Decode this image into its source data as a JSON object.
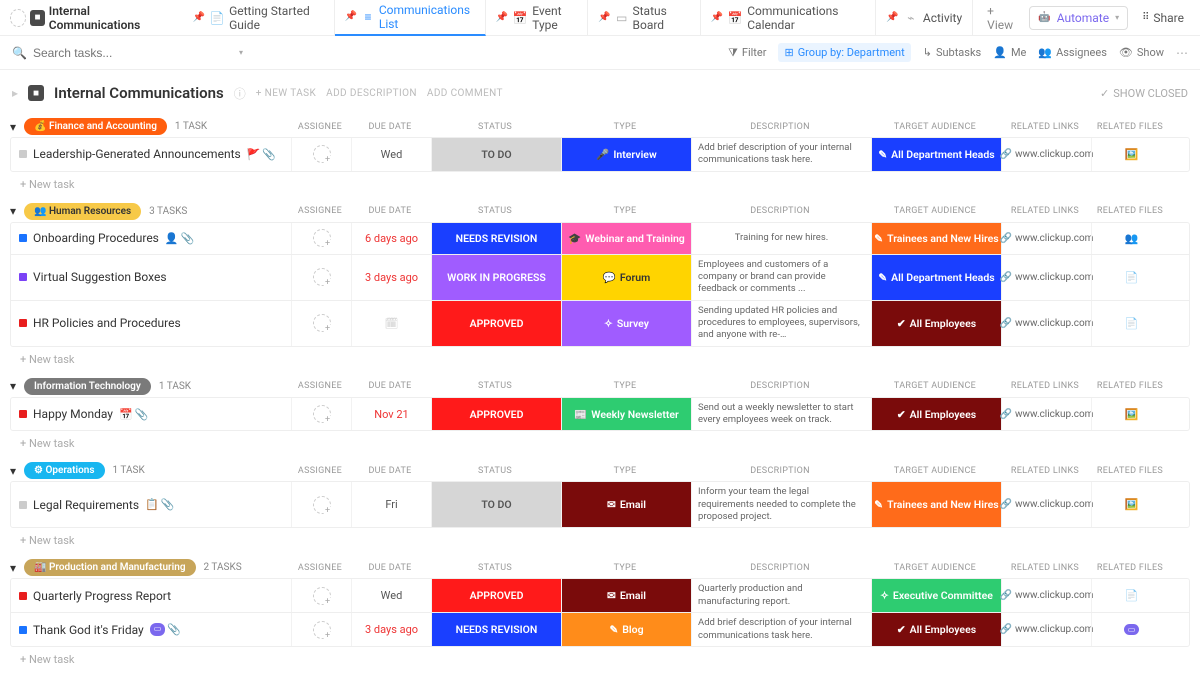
{
  "workspace": {
    "title": "Internal Communications"
  },
  "views": [
    {
      "label": "Getting Started Guide",
      "icon": "📄",
      "active": false
    },
    {
      "label": "Communications List",
      "icon": "≡",
      "active": true
    },
    {
      "label": "Event Type",
      "icon": "📅",
      "active": false
    },
    {
      "label": "Status Board",
      "icon": "▭",
      "active": false
    },
    {
      "label": "Communications Calendar",
      "icon": "📅",
      "active": false
    },
    {
      "label": "Activity",
      "icon": "⌁",
      "active": false
    }
  ],
  "add_view": "+ View",
  "automate": "Automate",
  "share": "Share",
  "search_placeholder": "Search tasks...",
  "toolbar": {
    "filter": "Filter",
    "group_by": "Group by: Department",
    "subtasks": "Subtasks",
    "me": "Me",
    "assignees": "Assignees",
    "show": "Show"
  },
  "page": {
    "title": "Internal Communications",
    "new_task": "+ NEW TASK",
    "add_description": "ADD DESCRIPTION",
    "add_comment": "ADD COMMENT",
    "show_closed": "SHOW CLOSED"
  },
  "columns": [
    "",
    "ASSIGNEE",
    "DUE DATE",
    "STATUS",
    "TYPE",
    "DESCRIPTION",
    "TARGET AUDIENCE",
    "RELATED LINKS",
    "RELATED FILES"
  ],
  "groups": [
    {
      "name": "Finance and Accounting",
      "pill_bg": "#ff5e0e",
      "icon": "💰",
      "task_count": "1 TASK",
      "tasks": [
        {
          "sq": "#ccc",
          "name": "Leadership-Generated Announcements",
          "badges": [
            "🚩",
            "📎"
          ],
          "due": "Wed",
          "due_color": "#555",
          "status": "TO DO",
          "status_bg": "#d6d6d6",
          "status_fg": "#555",
          "type": "Interview",
          "type_bg": "#1a3fff",
          "type_icon": "🎤",
          "desc": "Add brief description of your internal communications task here.",
          "aud": "All Department Heads",
          "aud_bg": "#1a3fff",
          "aud_icon": "✎",
          "link": "www.clickup.com",
          "file": "🖼️",
          "file_color": "#d66"
        }
      ]
    },
    {
      "name": "Human Resources",
      "pill_bg": "#f7c948",
      "pill_fg": "#333",
      "icon": "👥",
      "task_count": "3 TASKS",
      "tasks": [
        {
          "sq": "#1a73ff",
          "name": "Onboarding Procedures",
          "badges": [
            "👤",
            "📎"
          ],
          "due": "6 days ago",
          "due_color": "#e33",
          "status": "NEEDS REVISION",
          "status_bg": "#1a3fff",
          "type": "Webinar and Training",
          "type_bg": "#ff5cb0",
          "type_icon": "🎓",
          "desc": "Training for new hires.",
          "aud": "Trainees and New Hires",
          "aud_bg": "#ff6b1a",
          "aud_icon": "✎",
          "link": "www.clickup.com",
          "file": "👥",
          "file_color": "#333"
        },
        {
          "sq": "#7b42f6",
          "name": "Virtual Suggestion Boxes",
          "badges": [],
          "due": "3 days ago",
          "due_color": "#e33",
          "status": "WORK IN PROGRESS",
          "status_bg": "#a05cff",
          "type": "Forum",
          "type_bg": "#ffd400",
          "type_fg": "#333",
          "type_icon": "💬",
          "desc": "Employees and customers of a company or brand can provide feedback or comments ...",
          "aud": "All Department Heads",
          "aud_bg": "#1a3fff",
          "aud_icon": "✎",
          "link": "www.clickup.com",
          "file": "📄",
          "file_color": "#ccc"
        },
        {
          "sq": "#e81e1e",
          "name": "HR Policies and Procedures",
          "badges": [],
          "due": "",
          "due_icon": true,
          "status": "APPROVED",
          "status_bg": "#ff1a1a",
          "type": "Survey",
          "type_bg": "#a05cff",
          "type_icon": "✧",
          "desc": "Sending updated HR policies and procedures to employees, supervisors, and anyone with re-…",
          "aud": "All Employees",
          "aud_bg": "#7a0b0b",
          "aud_icon": "✔",
          "link": "www.clickup.com",
          "file": "📄",
          "file_color": "#ccc"
        }
      ]
    },
    {
      "name": "Information Technology",
      "pill_bg": "#7a7a7a",
      "icon": "",
      "task_count": "1 TASK",
      "tasks": [
        {
          "sq": "#e81e1e",
          "name": "Happy Monday",
          "badges": [
            "📅",
            "📎"
          ],
          "due": "Nov 21",
          "due_color": "#e33",
          "status": "APPROVED",
          "status_bg": "#ff1a1a",
          "type": "Weekly Newsletter",
          "type_bg": "#2ecc71",
          "type_icon": "📰",
          "desc": "Send out a weekly newsletter to start every employees week on track.",
          "aud": "All Employees",
          "aud_bg": "#7a0b0b",
          "aud_icon": "✔",
          "link": "www.clickup.com",
          "file": "🖼️",
          "file_color": "#888"
        }
      ]
    },
    {
      "name": "Operations",
      "pill_bg": "#18b6f0",
      "icon": "⚙",
      "task_count": "1 TASK",
      "tasks": [
        {
          "sq": "#ccc",
          "name": "Legal Requirements",
          "badges": [
            "📋",
            "📎"
          ],
          "due": "Fri",
          "due_color": "#555",
          "status": "TO DO",
          "status_bg": "#d6d6d6",
          "status_fg": "#555",
          "type": "Email",
          "type_bg": "#7a0b0b",
          "type_icon": "✉",
          "desc": "Inform your team the legal requirements needed to complete the proposed project.",
          "aud": "Trainees and New Hires",
          "aud_bg": "#ff6b1a",
          "aud_icon": "✎",
          "link": "www.clickup.com",
          "file": "🖼️",
          "file_color": "#888"
        }
      ]
    },
    {
      "name": "Production and Manufacturing",
      "pill_bg": "#c7a55a",
      "icon": "🏭",
      "task_count": "2 TASKS",
      "tasks": [
        {
          "sq": "#e81e1e",
          "name": "Quarterly Progress Report",
          "badges": [],
          "due": "Wed",
          "due_color": "#555",
          "status": "APPROVED",
          "status_bg": "#ff1a1a",
          "type": "Email",
          "type_bg": "#7a0b0b",
          "type_icon": "✉",
          "desc": "Quarterly production and manufacturing report.",
          "aud": "Executive Committee",
          "aud_bg": "#2ecc71",
          "aud_icon": "✧",
          "link": "www.clickup.com",
          "file": "📄",
          "file_color": "#ccc"
        },
        {
          "sq": "#1a73ff",
          "name": "Thank God it's Friday",
          "badges": [
            "chip",
            "📎"
          ],
          "due": "3 days ago",
          "due_color": "#e33",
          "status": "NEEDS REVISION",
          "status_bg": "#1a3fff",
          "type": "Blog",
          "type_bg": "#ff8c1a",
          "type_icon": "✎",
          "desc": "Add brief description of your internal communications task here.",
          "aud": "All Employees",
          "aud_bg": "#7a0b0b",
          "aud_icon": "✔",
          "link": "www.clickup.com",
          "file": "chip",
          "file_color": "#7b68ee"
        }
      ]
    }
  ],
  "new_task_label": "+ New task"
}
